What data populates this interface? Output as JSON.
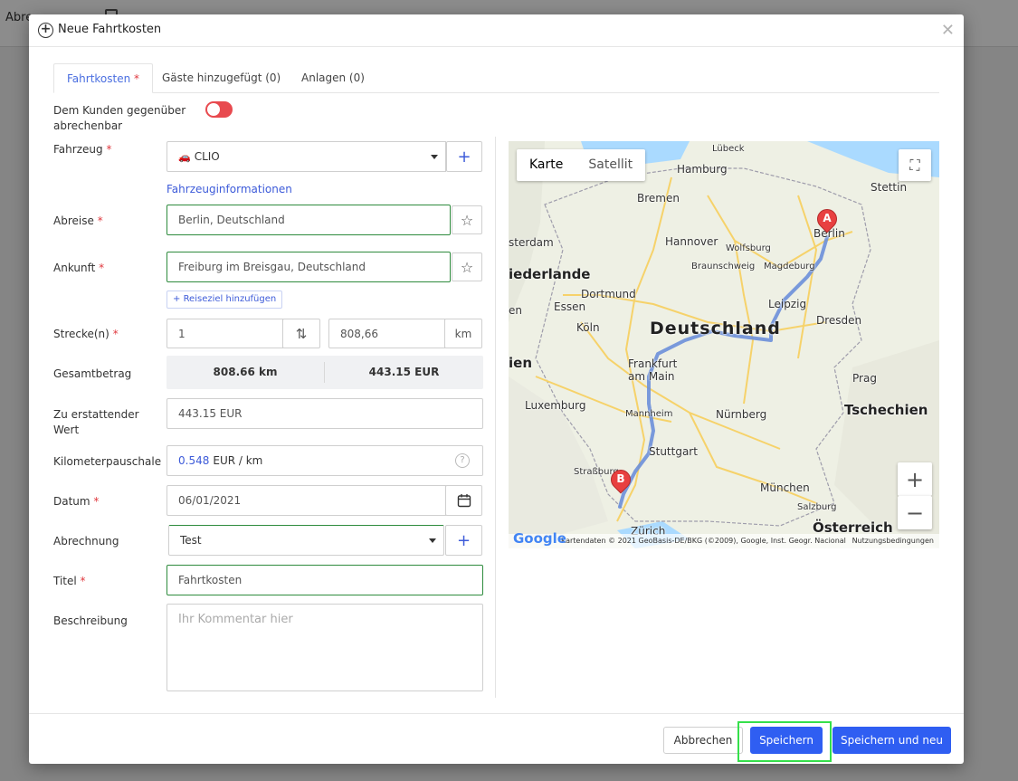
{
  "background": {
    "tab_partial": "Abre"
  },
  "modal": {
    "title": "Neue Fahrtkosten",
    "tabs": [
      {
        "label": "Fahrtkosten",
        "required": "*"
      },
      {
        "label": "Gäste hinzugefügt (0)"
      },
      {
        "label": "Anlagen (0)"
      }
    ],
    "billable_label_line1": "Dem Kunden gegenüber",
    "billable_label_line2": "abrechenbar",
    "vehicle": {
      "label": "Fahrzeug",
      "value": "CLIO",
      "info_link": "Fahrzeuginformationen"
    },
    "departure": {
      "label": "Abreise",
      "value": "Berlin, Deutschland"
    },
    "arrival": {
      "label": "Ankunft",
      "value": "Freiburg im Breisgau, Deutschland"
    },
    "add_destination": "Reiseziel hinzufügen",
    "routes": {
      "label": "Strecke(n)",
      "count": "1",
      "distance": "808,66",
      "unit": "km"
    },
    "total": {
      "label": "Gesamtbetrag",
      "km": "808.66 km",
      "eur": "443.15 EUR"
    },
    "refund": {
      "label_line1": "Zu erstattender",
      "label_line2": "Wert",
      "value": "443.15 EUR"
    },
    "mileage": {
      "label": "Kilometerpauschale",
      "rate": "0.548",
      "unit": "EUR / km"
    },
    "date": {
      "label": "Datum",
      "value": "06/01/2021"
    },
    "billing": {
      "label": "Abrechnung",
      "value": "Test"
    },
    "title_field": {
      "label": "Titel",
      "value": "Fahrtkosten"
    },
    "description": {
      "label": "Beschreibung",
      "placeholder": "Ihr Kommentar hier"
    },
    "required_mark": "*"
  },
  "map": {
    "type_map": "Karte",
    "type_satellite": "Satellit",
    "cities": {
      "luebeck": "Lübeck",
      "hamburg": "Hamburg",
      "stettin": "Stettin",
      "bremen": "Bremen",
      "berlin": "Berlin",
      "amsterdam": "sterdam",
      "hannover": "Hannover",
      "wolfsburg": "Wolfsburg",
      "niederlande": "iederlande",
      "braunschweig": "Braunschweig",
      "magdeburg": "Magdeburg",
      "dortmund": "Dortmund",
      "essen": "Essen",
      "leipzig": "Leipzig",
      "en": "en",
      "koeln": "Köln",
      "deutschland": "Deutschland",
      "dresden": "Dresden",
      "frankfurt1": "Frankfurt",
      "frankfurt2": "am Main",
      "ien": "ien",
      "prag": "Prag",
      "luxemburg": "Luxemburg",
      "mannheim": "Mannheim",
      "nuernberg": "Nürnberg",
      "tschechien": "Tschechien",
      "stuttgart": "Stuttgart",
      "strassburg": "Straßburg",
      "muenchen": "München",
      "salzburg": "Salzburg",
      "zuerich": "Zürich",
      "oesterreich": "Österreich"
    },
    "marker_a": "A",
    "marker_b": "B",
    "google": "Google",
    "attribution": "Kartendaten © 2021 GeoBasis-DE/BKG (©2009), Google, Inst. Geogr. Nacional",
    "terms": "Nutzungsbedingungen",
    "zoom_in": "+",
    "zoom_out": "−"
  },
  "footer": {
    "cancel": "Abbrechen",
    "save": "Speichern",
    "save_new": "Speichern und neu"
  }
}
